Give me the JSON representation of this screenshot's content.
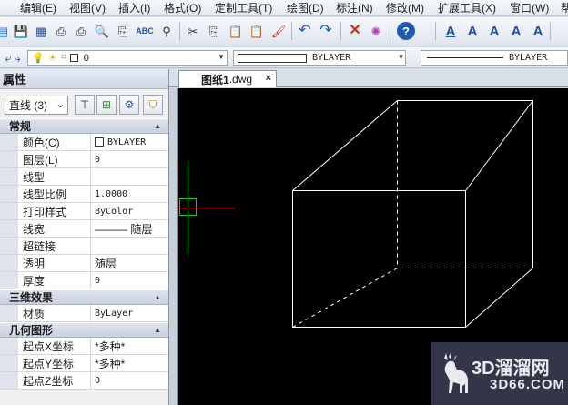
{
  "menubar": {
    "items": [
      "编辑(E)",
      "视图(V)",
      "插入(I)",
      "格式(O)",
      "定制工具(T)",
      "绘图(D)",
      "标注(N)",
      "修改(M)",
      "扩展工具(X)",
      "窗口(W)",
      "帮"
    ]
  },
  "toolbar2": {
    "layer_value": "0",
    "color_value": "BYLAYER",
    "linetype_value": "BYLAYER"
  },
  "properties": {
    "title": "属性",
    "selection": "直线 (3)",
    "sections": [
      {
        "title": "常规",
        "rows": [
          {
            "name": "颜色(C)",
            "value": "BYLAYER"
          },
          {
            "name": "图层(L)",
            "value": "0"
          },
          {
            "name": "线型",
            "value": ""
          },
          {
            "name": "线型比例",
            "value": "1.0000"
          },
          {
            "name": "打印样式",
            "value": "ByColor"
          },
          {
            "name": "线宽",
            "value": "——— 随层"
          },
          {
            "name": "超链接",
            "value": ""
          },
          {
            "name": "透明",
            "value": "随层"
          },
          {
            "name": "厚度",
            "value": "0"
          }
        ]
      },
      {
        "title": "三维效果",
        "rows": [
          {
            "name": "材质",
            "value": "ByLayer"
          }
        ]
      },
      {
        "title": "几何图形",
        "rows": [
          {
            "name": "起点X坐标",
            "value": "*多种*"
          },
          {
            "name": "起点Y坐标",
            "value": "*多种*"
          },
          {
            "name": "起点Z坐标",
            "value": "0"
          }
        ]
      }
    ]
  },
  "tab": {
    "title": "图纸1",
    "ext": ".dwg",
    "close": "×"
  },
  "watermark": {
    "text1": "3D溜溜网",
    "text2": "3D66.COM"
  },
  "colors": {
    "canvas_bg": "#000000",
    "wire": "#ffffff",
    "cursor_x": "#c8201e",
    "cursor_y": "#1ec81e"
  }
}
